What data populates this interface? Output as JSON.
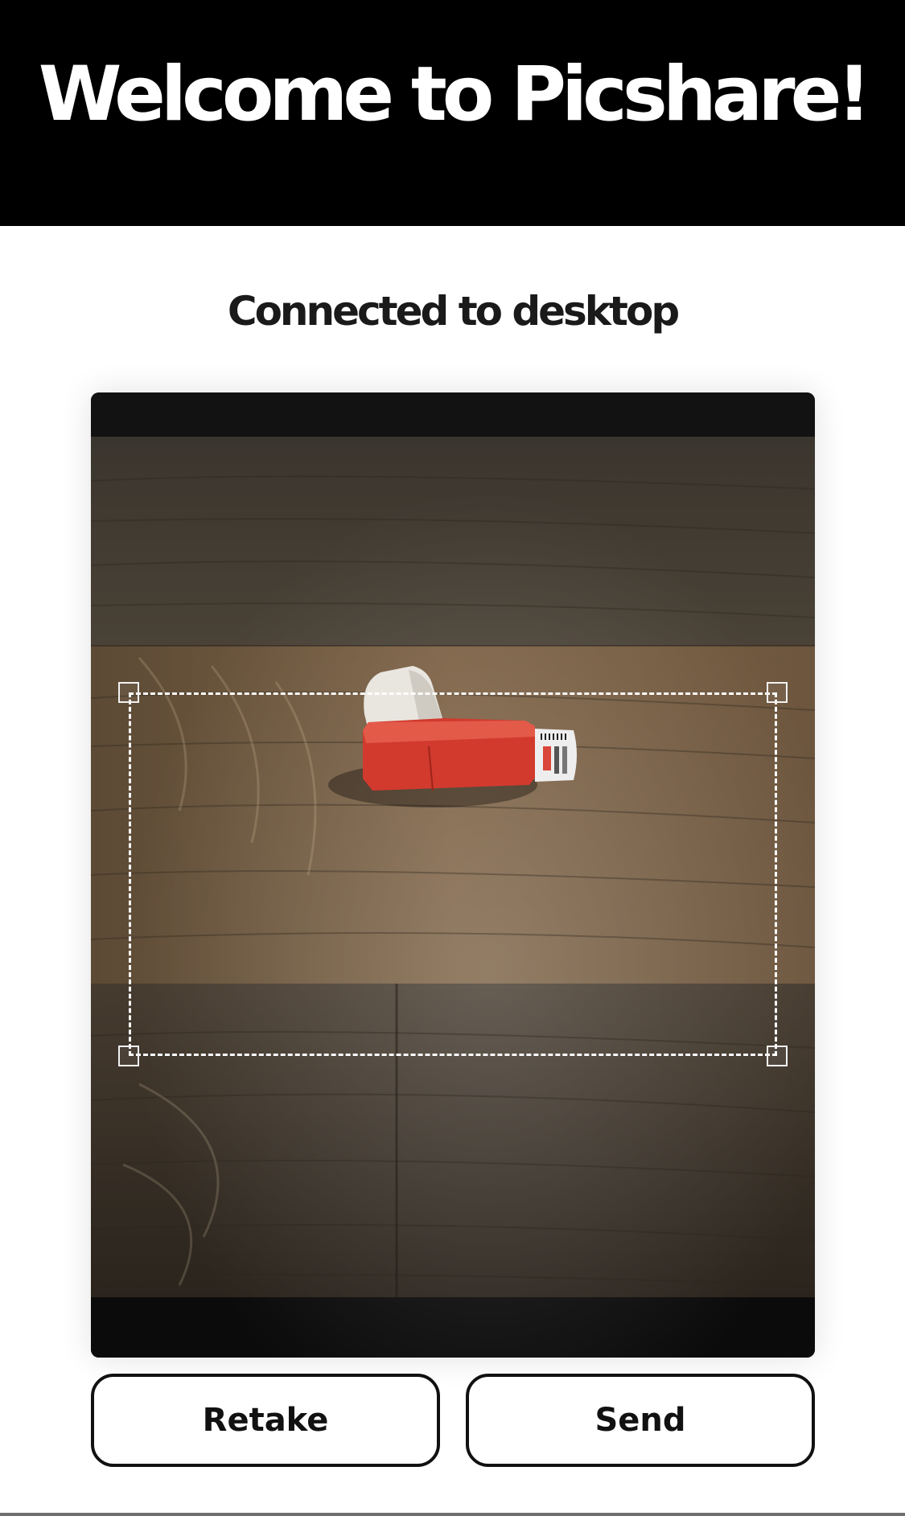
{
  "header": {
    "title": "Welcome to Picshare!"
  },
  "status": {
    "text": "Connected to desktop"
  },
  "photo": {
    "subject": "inhaler-on-wooden-table"
  },
  "actions": {
    "retake_label": "Retake",
    "send_label": "Send"
  },
  "colors": {
    "header_bg": "#000000",
    "header_text": "#ffffff",
    "inhaler_body": "#d23a2e",
    "inhaler_cap": "#e9e6df",
    "button_border": "#111111"
  }
}
